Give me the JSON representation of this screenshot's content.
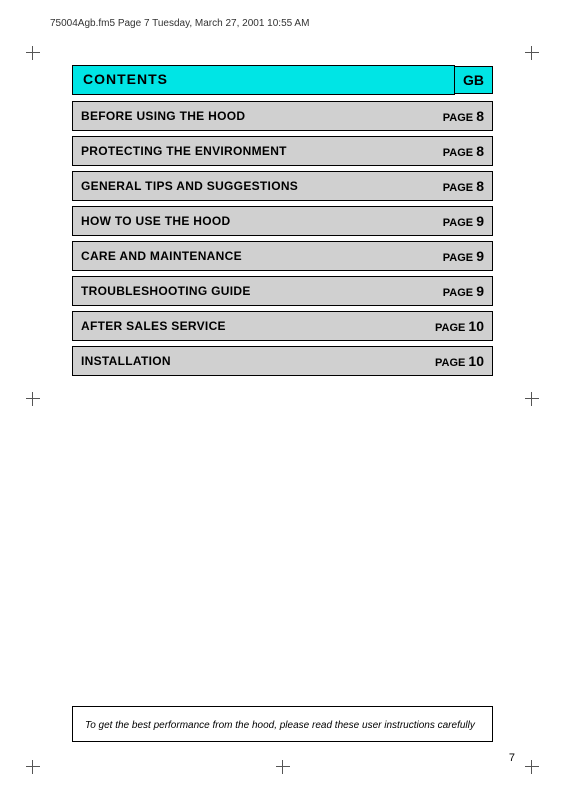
{
  "header": {
    "file_info": "75004Agb.fm5  Page 7  Tuesday, March 27, 2001  10:55 AM"
  },
  "contents": {
    "title": "CONTENTS",
    "gb_label": "GB",
    "items": [
      {
        "title": "BEFORE USING THE HOOD",
        "page_label": "PAGE",
        "page_num": "8"
      },
      {
        "title": "PROTECTING THE ENVIRONMENT",
        "page_label": "PAGE",
        "page_num": "8"
      },
      {
        "title": "GENERAL TIPS AND SUGGESTIONS",
        "page_label": "PAGE",
        "page_num": "8"
      },
      {
        "title": "HOW TO USE THE HOOD",
        "page_label": "PAGE",
        "page_num": "9"
      },
      {
        "title": "CARE AND MAINTENANCE",
        "page_label": "PAGE",
        "page_num": "9"
      },
      {
        "title": "TROUBLESHOOTING GUIDE",
        "page_label": "PAGE",
        "page_num": "9"
      },
      {
        "title": "AFTER SALES SERVICE",
        "page_label": "PAGE",
        "page_num": "10"
      },
      {
        "title": "INSTALLATION",
        "page_label": "PAGE",
        "page_num": "10"
      }
    ]
  },
  "bottom_note": "To get the best performance from the hood, please read these user instructions carefully",
  "page_number": "7"
}
